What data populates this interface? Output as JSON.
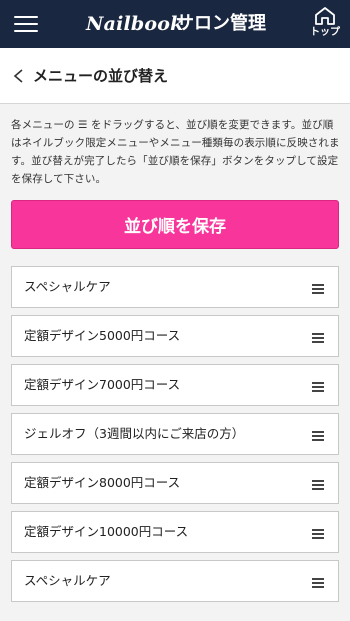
{
  "header": {
    "logo_text": "Nailbook",
    "title": "サロン管理",
    "top_label": "トップ",
    "bg_color": "#1a2740"
  },
  "page": {
    "title": "メニューの並び替え"
  },
  "description": {
    "text": "各メニューの ☰ をドラッグすると、並び順を変更できます。並び順はネイルブック限定メニューやメニュー種類毎の表示順に反映されます。並び替えが完了したら「並び順を保存」ボタンをタップして設定を保存して下さい。"
  },
  "save_button": {
    "label": "並び順を保存",
    "color": "#f7359a"
  },
  "menu_items": [
    {
      "label": "スペシャルケア"
    },
    {
      "label": "定額デザイン5000円コース"
    },
    {
      "label": "定額デザイン7000円コース"
    },
    {
      "label": "ジェルオフ（3週間以内にご来店の方）"
    },
    {
      "label": "定額デザイン8000円コース"
    },
    {
      "label": "定額デザイン10000円コース"
    },
    {
      "label": "スペシャルケア"
    }
  ],
  "icons": {
    "menu": "hamburger-menu-icon",
    "home": "home-icon",
    "back": "chevron-left-icon",
    "drag": "drag-handle-icon"
  }
}
